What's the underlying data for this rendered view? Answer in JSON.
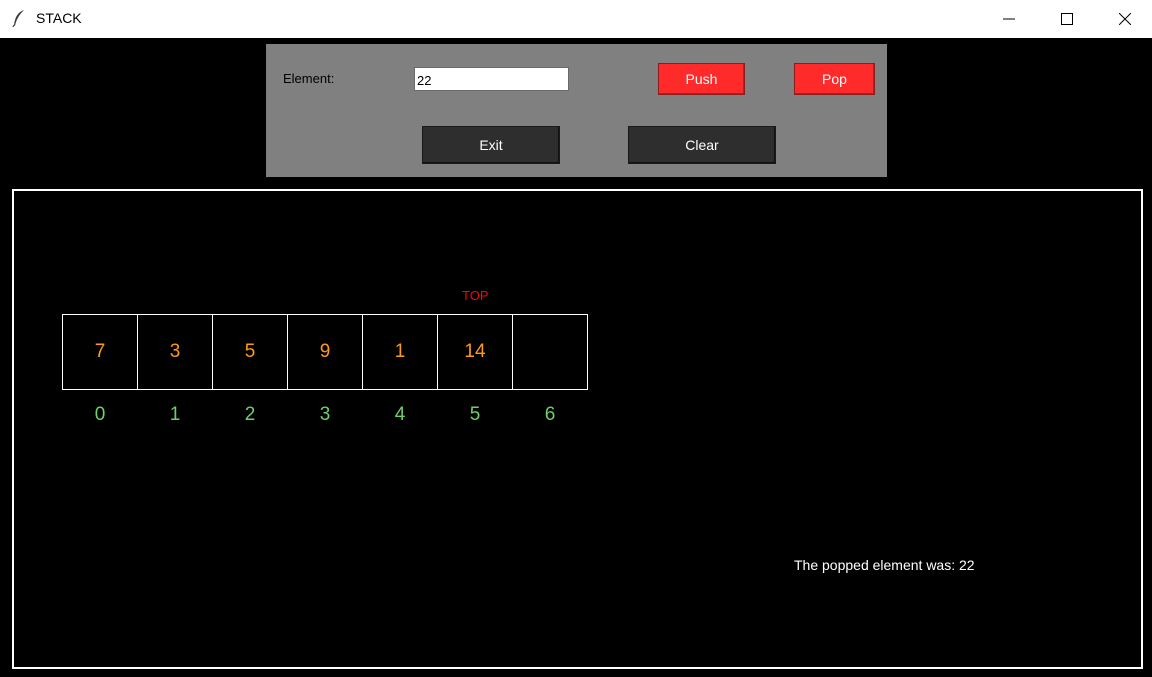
{
  "window": {
    "title": "STACK",
    "icon": "feather-icon"
  },
  "controls": {
    "element_label": "Element:",
    "element_value": "22",
    "push_label": "Push",
    "pop_label": "Pop",
    "exit_label": "Exit",
    "clear_label": "Clear"
  },
  "stack": {
    "top_label": "TOP",
    "cells": [
      "7",
      "3",
      "5",
      "9",
      "1",
      "14",
      ""
    ],
    "indices": [
      "0",
      "1",
      "2",
      "3",
      "4",
      "5",
      "6"
    ]
  },
  "status": {
    "message": "The popped element was: 22"
  },
  "colors": {
    "background": "#000000",
    "panel": "#808080",
    "accent_red": "#ff2b2b",
    "button_dark": "#2e2e2e",
    "value_orange": "#ff9a1a",
    "index_green": "#6fcf6a",
    "top_red": "#ff0000"
  }
}
